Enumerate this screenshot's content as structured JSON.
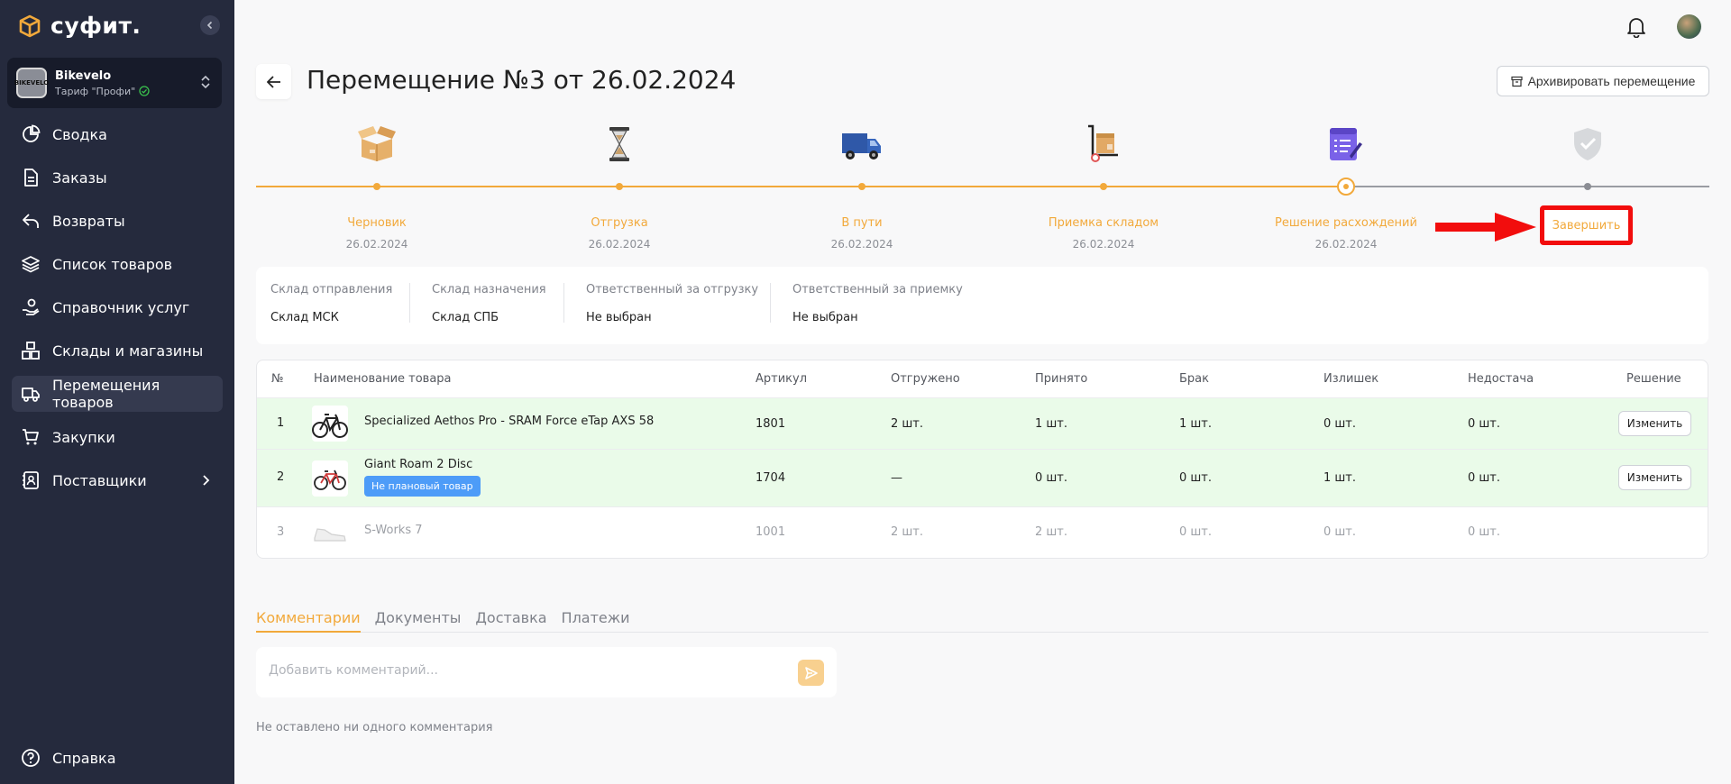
{
  "brand": {
    "logo_text": "суфит."
  },
  "account": {
    "name": "Bikevelo",
    "plan": "Тариф \"Профи\"",
    "avatar_text": "BIKEVELO"
  },
  "sidebar": {
    "items": [
      {
        "label": "Сводка",
        "icon": "pie-chart-icon"
      },
      {
        "label": "Заказы",
        "icon": "document-icon"
      },
      {
        "label": "Возвраты",
        "icon": "return-arrow-icon"
      },
      {
        "label": "Список товаров",
        "icon": "layers-icon"
      },
      {
        "label": "Справочник услуг",
        "icon": "hand-service-icon"
      },
      {
        "label": "Склады и магазины",
        "icon": "boxes-icon"
      },
      {
        "label": "Перемещения товаров",
        "icon": "truck-icon",
        "active": true
      },
      {
        "label": "Закупки",
        "icon": "cart-icon"
      },
      {
        "label": "Поставщики",
        "icon": "contacts-icon",
        "has_submenu": true
      }
    ],
    "help_label": "Справка"
  },
  "header": {
    "title": "Перемещение №3 от 26.02.2024",
    "archive_label": "Архивировать перемещение"
  },
  "stepper": {
    "progress_color": "#f2a93b",
    "steps": [
      {
        "label": "Черновик",
        "date": "26.02.2024",
        "icon": "open-box-icon",
        "state": "done"
      },
      {
        "label": "Отгрузка",
        "date": "26.02.2024",
        "icon": "hourglass-icon",
        "state": "done"
      },
      {
        "label": "В пути",
        "date": "26.02.2024",
        "icon": "delivery-truck-icon",
        "state": "done"
      },
      {
        "label": "Приемка складом",
        "date": "26.02.2024",
        "icon": "hand-cart-icon",
        "state": "done"
      },
      {
        "label": "Решение расхождений",
        "date": "26.02.2024",
        "icon": "checklist-icon",
        "state": "current"
      },
      {
        "label": "Завершить",
        "icon": "shield-check-icon",
        "state": "todo"
      }
    ]
  },
  "info": {
    "from_label": "Склад отправления",
    "from_value": "Склад МСК",
    "to_label": "Склад назначения",
    "to_value": "Склад СПБ",
    "shipper_label": "Ответственный за отгрузку",
    "shipper_value": "Не выбран",
    "receiver_label": "Ответственный за приемку",
    "receiver_value": "Не выбран"
  },
  "table": {
    "headers": {
      "num": "№",
      "name": "Наименование товара",
      "sku": "Артикул",
      "shipped": "Отгружено",
      "received": "Принято",
      "defect": "Брак",
      "surplus": "Излишек",
      "shortage": "Недостача",
      "decision": "Решение"
    },
    "rows": [
      {
        "num": "1",
        "name": "Specialized Aethos Pro - SRAM Force eTap AXS 58",
        "sku": "1801",
        "shipped": "2 шт.",
        "received": "1 шт.",
        "defect": "1 шт.",
        "surplus": "0 шт.",
        "shortage": "0 шт.",
        "action": "Изменить"
      },
      {
        "num": "2",
        "name": "Giant Roam 2 Disc",
        "badge": "Не плановый товар",
        "sku": "1704",
        "shipped": "—",
        "received": "0 шт.",
        "defect": "0 шт.",
        "surplus": "1 шт.",
        "shortage": "0 шт.",
        "action": "Изменить"
      },
      {
        "num": "3",
        "name": "S-Works 7",
        "sku": "1001",
        "shipped": "2 шт.",
        "received": "2 шт.",
        "defect": "0 шт.",
        "surplus": "0 шт.",
        "shortage": "0 шт."
      }
    ]
  },
  "tabs": [
    "Комментарии",
    "Документы",
    "Доставка",
    "Платежи"
  ],
  "comments": {
    "placeholder": "Добавить комментарий...",
    "empty_text": "Не оставлено ни одного комментария"
  }
}
